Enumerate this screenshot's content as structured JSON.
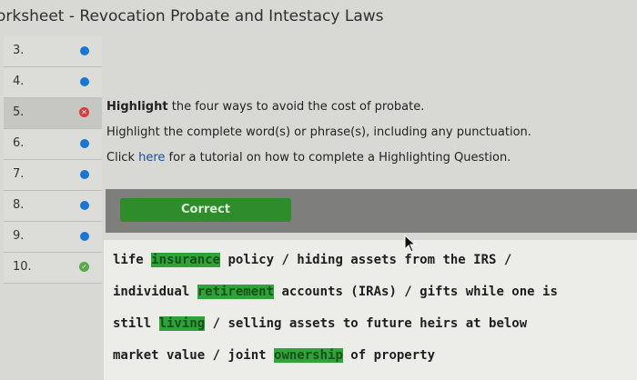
{
  "title": "orksheet - Revocation Probate and Intestacy Laws",
  "sidebar": {
    "items": [
      {
        "label": "3."
      },
      {
        "label": "4."
      },
      {
        "label": "5."
      },
      {
        "label": "6."
      },
      {
        "label": "7."
      },
      {
        "label": "8."
      },
      {
        "label": "9."
      },
      {
        "label": "10."
      }
    ]
  },
  "question": {
    "line1_bold": "Highlight",
    "line1_rest": " the four ways to avoid the cost of probate.",
    "line2": "Highlight the complete word(s) or phrase(s), including any punctuation.",
    "line3_pre": "Click ",
    "line3_link": "here",
    "line3_post": " for a tutorial on how to complete a Highlighting Question."
  },
  "result": {
    "label": "Correct"
  },
  "answer": {
    "l1a": "life ",
    "l1hl": "insurance",
    "l1b": " policy / hiding assets from the IRS /",
    "l2a": "individual ",
    "l2hl": "retirement",
    "l2b": " accounts (IRAs) / gifts while one is",
    "l3a": "still ",
    "l3hl": "living",
    "l3b": " / selling assets to future heirs at below",
    "l4a": "market value / joint ",
    "l4hl": "ownership",
    "l4b": " of property"
  },
  "colors": {
    "accent_blue": "#1976d2",
    "correct_green": "#2f8c2a",
    "highlight_green": "#2fa23a",
    "error_red": "#d93b3b"
  }
}
